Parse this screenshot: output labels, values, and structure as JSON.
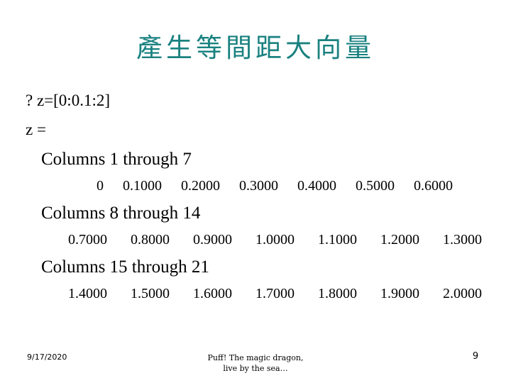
{
  "slide": {
    "title": "產生等間距大向量",
    "title_color": "#1a8280",
    "background_color": "#ffffff",
    "text_color": "#000000"
  },
  "body": {
    "command_line": "? z=[0:0.1:2]",
    "result_label": "z =",
    "blocks": [
      {
        "heading": "Columns 1 through 7",
        "values": [
          "0",
          "0.1000",
          "0.2000",
          "0.3000",
          "0.4000",
          "0.5000",
          "0.6000"
        ]
      },
      {
        "heading": "Columns 8 through 14",
        "values": [
          "0.7000",
          "0.8000",
          "0.9000",
          "1.0000",
          "1.1000",
          "1.2000",
          "1.3000"
        ]
      },
      {
        "heading": "Columns 15 through 21",
        "values": [
          "1.4000",
          "1.5000",
          "1.6000",
          "1.7000",
          "1.8000",
          "1.9000",
          "2.0000"
        ]
      }
    ]
  },
  "footer": {
    "date": "9/17/2020",
    "center_line_1": "Puff! The magic dragon,",
    "center_line_2": "live by the sea…",
    "page_number": "9"
  }
}
